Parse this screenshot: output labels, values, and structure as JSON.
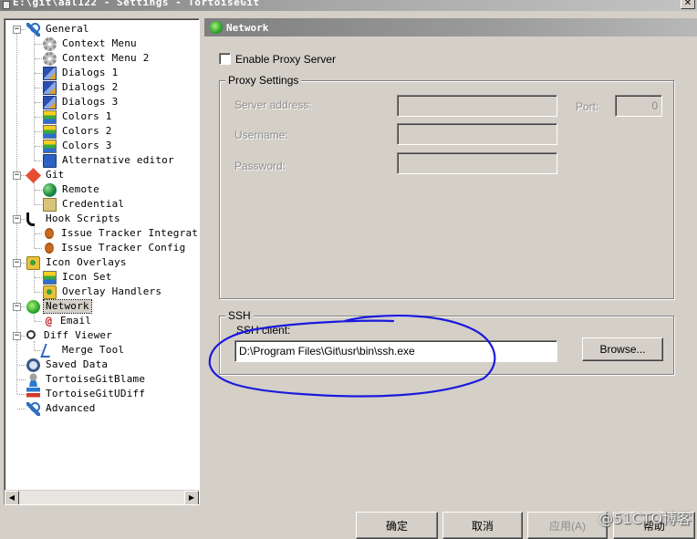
{
  "window": {
    "title": "E:\\git\\aal122 - Settings - TortoiseGit"
  },
  "tree": {
    "items": [
      {
        "label": "General",
        "icon": "wrench-icon"
      },
      {
        "label": "Context Menu",
        "icon": "gear-icon"
      },
      {
        "label": "Context Menu 2",
        "icon": "gear-icon"
      },
      {
        "label": "Dialogs 1",
        "icon": "dialog-icon"
      },
      {
        "label": "Dialogs 2",
        "icon": "dialog-icon"
      },
      {
        "label": "Dialogs 3",
        "icon": "dialog-icon"
      },
      {
        "label": "Colors 1",
        "icon": "colors-icon"
      },
      {
        "label": "Colors 2",
        "icon": "colors-icon"
      },
      {
        "label": "Colors 3",
        "icon": "colors-icon"
      },
      {
        "label": "Alternative editor",
        "icon": "book-icon"
      },
      {
        "label": "Git",
        "icon": "git-icon"
      },
      {
        "label": "Remote",
        "icon": "globe-icon"
      },
      {
        "label": "Credential",
        "icon": "credential-icon"
      },
      {
        "label": "Hook Scripts",
        "icon": "hook-icon"
      },
      {
        "label": "Issue Tracker Integration",
        "icon": "bug-icon"
      },
      {
        "label": "Issue Tracker Config",
        "icon": "bug-icon"
      },
      {
        "label": "Icon Overlays",
        "icon": "overlay-icon"
      },
      {
        "label": "Icon Set",
        "icon": "colors-icon"
      },
      {
        "label": "Overlay Handlers",
        "icon": "overlay-icon"
      },
      {
        "label": "Network",
        "icon": "network-icon",
        "selected": true
      },
      {
        "label": "Email",
        "icon": "email-icon"
      },
      {
        "label": "Diff Viewer",
        "icon": "magnifier-icon"
      },
      {
        "label": "Merge Tool",
        "icon": "merge-icon"
      },
      {
        "label": "Saved Data",
        "icon": "saved-data-icon"
      },
      {
        "label": "TortoiseGitBlame",
        "icon": "blame-icon"
      },
      {
        "label": "TortoiseGitUDiff",
        "icon": "udiff-icon"
      },
      {
        "label": "Advanced",
        "icon": "wrench-icon"
      }
    ]
  },
  "panel": {
    "header": "Network",
    "enable_proxy_label": "Enable Proxy Server",
    "enable_proxy_checked": false,
    "proxy_settings": {
      "title": "Proxy Settings",
      "server_address_label": "Server address:",
      "server_address_value": "",
      "port_label": "Port:",
      "port_value": "0",
      "username_label": "Username:",
      "username_value": "",
      "password_label": "Password:",
      "password_value": ""
    },
    "ssh": {
      "title": "SSH",
      "client_label": "SSH client:",
      "client_value": "D:\\Program Files\\Git\\usr\\bin\\ssh.exe",
      "browse_label": "Browse..."
    }
  },
  "footer": {
    "ok_label": "确定",
    "cancel_label": "取消",
    "apply_label": "应用(A)",
    "help_label": "帮助"
  },
  "annotation": {
    "color": "#1a1adc"
  },
  "watermark": "@51CTO博客"
}
